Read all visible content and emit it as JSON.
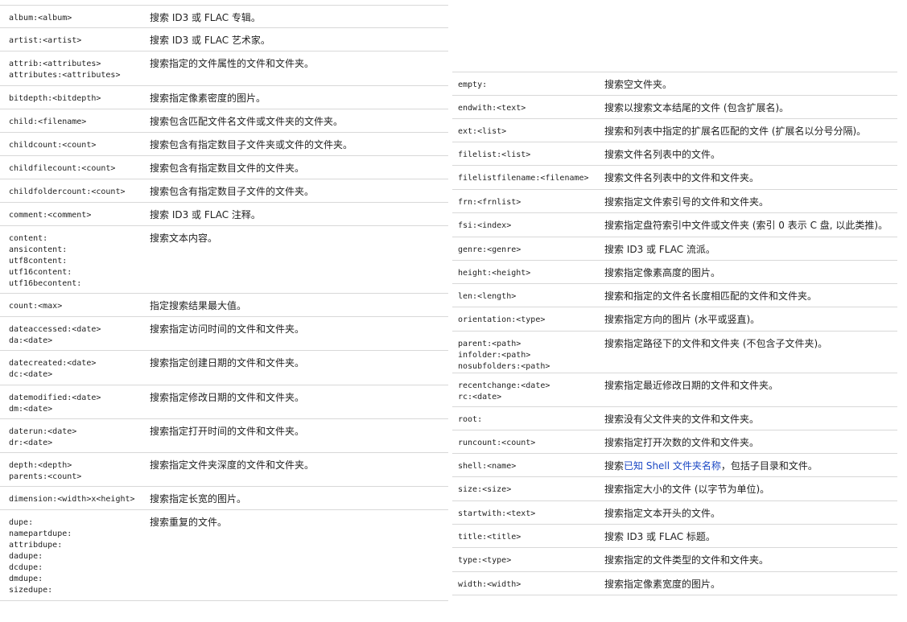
{
  "left_rows": [
    {
      "keys": [
        "album:<album>"
      ],
      "desc": "搜索 ID3 或 FLAC 专辑。"
    },
    {
      "keys": [
        "artist:<artist>"
      ],
      "desc": "搜索 ID3 或 FLAC 艺术家。"
    },
    {
      "keys": [
        "attrib:<attributes>",
        "attributes:<attributes>"
      ],
      "desc": "搜索指定的文件属性的文件和文件夹。"
    },
    {
      "keys": [
        "bitdepth:<bitdepth>"
      ],
      "desc": "搜索指定像素密度的图片。"
    },
    {
      "keys": [
        "child:<filename>"
      ],
      "desc": "搜索包含匹配文件名文件或文件夹的文件夹。"
    },
    {
      "keys": [
        "childcount:<count>"
      ],
      "desc": "搜索包含有指定数目子文件夹或文件的文件夹。"
    },
    {
      "keys": [
        "childfilecount:<count>"
      ],
      "desc": "搜索包含有指定数目文件的文件夹。"
    },
    {
      "keys": [
        "childfoldercount:<count>"
      ],
      "desc": "搜索包含有指定数目子文件的文件夹。"
    },
    {
      "keys": [
        "comment:<comment>"
      ],
      "desc": "搜索 ID3 或 FLAC 注释。"
    },
    {
      "keys": [
        "content:",
        "ansicontent:",
        "utf8content:",
        "utf16content:",
        "utf16becontent:"
      ],
      "desc": "搜索文本内容。"
    },
    {
      "keys": [
        "count:<max>"
      ],
      "desc": "指定搜索结果最大值。"
    },
    {
      "keys": [
        "dateaccessed:<date>",
        "da:<date>"
      ],
      "desc": "搜索指定访问时间的文件和文件夹。"
    },
    {
      "keys": [
        "datecreated:<date>",
        "dc:<date>"
      ],
      "desc": "搜索指定创建日期的文件和文件夹。"
    },
    {
      "keys": [
        "datemodified:<date>",
        "dm:<date>"
      ],
      "desc": "搜索指定修改日期的文件和文件夹。"
    },
    {
      "keys": [
        "daterun:<date>",
        "dr:<date>"
      ],
      "desc": "搜索指定打开时间的文件和文件夹。"
    },
    {
      "keys": [
        "depth:<depth>",
        "parents:<count>"
      ],
      "desc": "搜索指定文件夹深度的文件和文件夹。"
    },
    {
      "keys": [
        "dimension:<width>x<height>"
      ],
      "desc": "搜索指定长宽的图片。"
    },
    {
      "keys": [
        "dupe:",
        "namepartdupe:",
        "attribdupe:",
        "dadupe:",
        "dcdupe:",
        "dmdupe:",
        "sizedupe:"
      ],
      "desc": "搜索重复的文件。"
    }
  ],
  "right_rows": [
    {
      "keys": [
        "empty:"
      ],
      "desc": "搜索空文件夹。"
    },
    {
      "keys": [
        "endwith:<text>"
      ],
      "desc": "搜索以搜索文本结尾的文件 (包含扩展名)。"
    },
    {
      "keys": [
        "ext:<list>"
      ],
      "desc": "搜索和列表中指定的扩展名匹配的文件 (扩展名以分号分隔)。"
    },
    {
      "keys": [
        "filelist:<list>"
      ],
      "desc": "搜索文件名列表中的文件。"
    },
    {
      "keys": [
        "filelistfilename:<filename>"
      ],
      "desc": "搜索文件名列表中的文件和文件夹。"
    },
    {
      "keys": [
        "frn:<frnlist>"
      ],
      "desc": "搜索指定文件索引号的文件和文件夹。"
    },
    {
      "keys": [
        "fsi:<index>"
      ],
      "desc": "搜索指定盘符索引中文件或文件夹 (索引 0 表示 C 盘, 以此类推)。"
    },
    {
      "keys": [
        "genre:<genre>"
      ],
      "desc": "搜索 ID3 或 FLAC 流派。"
    },
    {
      "keys": [
        "height:<height>"
      ],
      "desc": "搜索指定像素高度的图片。"
    },
    {
      "keys": [
        "len:<length>"
      ],
      "desc": "搜索和指定的文件名长度相匹配的文件和文件夹。"
    },
    {
      "keys": [
        "orientation:<type>"
      ],
      "desc": "搜索指定方向的图片 (水平或竖直)。"
    },
    {
      "keys": [
        "parent:<path>",
        "infolder:<path>",
        "nosubfolders:<path>"
      ],
      "desc": "搜索指定路径下的文件和文件夹 (不包含子文件夹)。"
    },
    {
      "keys": [
        "recentchange:<date>",
        "rc:<date>"
      ],
      "desc": "搜索指定最近修改日期的文件和文件夹。"
    },
    {
      "keys": [
        "root:"
      ],
      "desc": "搜索没有父文件夹的文件和文件夹。"
    },
    {
      "keys": [
        "runcount:<count>"
      ],
      "desc": "搜索指定打开次数的文件和文件夹。"
    },
    {
      "keys": [
        "shell:<name>"
      ],
      "desc_pre": "搜索",
      "desc_link": "已知 Shell 文件夹名称",
      "desc_post": "，包括子目录和文件。"
    },
    {
      "keys": [
        "size:<size>"
      ],
      "desc": "搜索指定大小的文件 (以字节为单位)。"
    },
    {
      "keys": [
        "startwith:<text>"
      ],
      "desc": "搜索指定文本开头的文件。"
    },
    {
      "keys": [
        "title:<title>"
      ],
      "desc": "搜索 ID3 或 FLAC 标题。"
    },
    {
      "keys": [
        "type:<type>"
      ],
      "desc": "搜索指定的文件类型的文件和文件夹。"
    },
    {
      "keys": [
        "width:<width>"
      ],
      "desc": "搜索指定像素宽度的图片。"
    }
  ]
}
